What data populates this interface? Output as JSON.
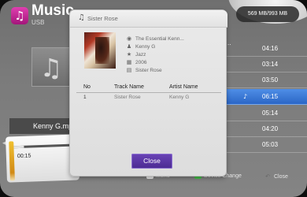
{
  "app": {
    "title": "Music",
    "device": "USB",
    "capacity": "569 MB/993 MB"
  },
  "background": {
    "file_name": "Kenny G.mp3",
    "progress_time": "00:15",
    "progress_fraction": 0.18,
    "tracks": [
      {
        "time": "04:16",
        "active": false
      },
      {
        "time": "03:14",
        "active": false
      },
      {
        "time": "03:50",
        "active": false
      },
      {
        "time": "06:15",
        "active": true
      },
      {
        "time": "05:14",
        "active": false
      },
      {
        "time": "04:20",
        "active": false
      },
      {
        "time": "05:03",
        "active": false
      }
    ]
  },
  "dialog": {
    "title": "Sister Rose",
    "metadata": [
      {
        "icon": "disc-icon",
        "text": "The Essential Kenn..."
      },
      {
        "icon": "person-icon",
        "text": "Kenny G"
      },
      {
        "icon": "star-icon",
        "text": "Jazz"
      },
      {
        "icon": "calendar-icon",
        "text": "2006"
      },
      {
        "icon": "file-icon",
        "text": "Sister Rose"
      }
    ],
    "table": {
      "headers": [
        "No",
        "Track Name",
        "Artist Name"
      ],
      "rows": [
        [
          "1",
          "Sister Rose",
          "Kenny G"
        ]
      ]
    },
    "close_label": "Close"
  },
  "legend": {
    "menu": "Menu",
    "device_change": "Device Change",
    "close": "Close"
  }
}
